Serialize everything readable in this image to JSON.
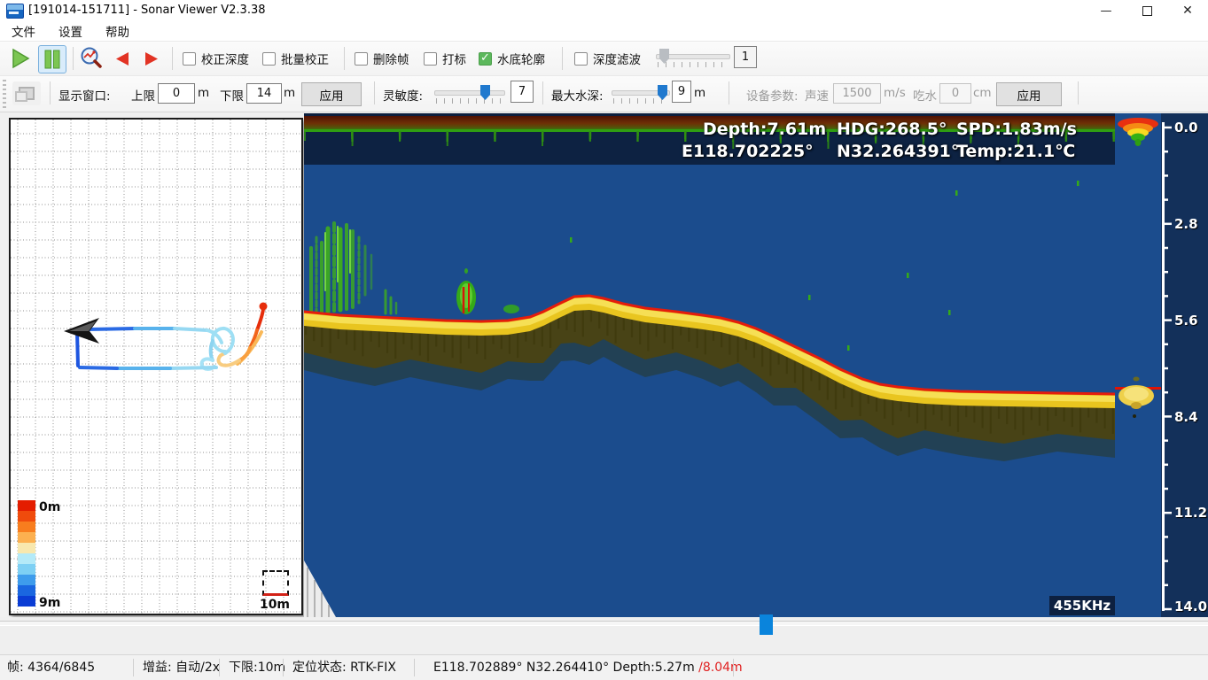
{
  "window": {
    "title": "[191014-151711] - Sonar Viewer V2.3.38",
    "minimize": "—",
    "close": "✕"
  },
  "menu": {
    "items": [
      "文件",
      "设置",
      "帮助"
    ]
  },
  "toolbar1": {
    "checkboxes": [
      {
        "label": "校正深度",
        "checked": false
      },
      {
        "label": "批量校正",
        "checked": false
      },
      {
        "label": "删除帧",
        "checked": false
      },
      {
        "label": "打标",
        "checked": false
      },
      {
        "label": "水底轮廓",
        "checked": true
      },
      {
        "label": "深度滤波",
        "checked": false
      }
    ],
    "filter_slider_value": "1"
  },
  "toolbar2": {
    "display_window_label": "显示窗口:",
    "upper_label": "上限",
    "upper_value": "0",
    "upper_unit": "m",
    "lower_label": "下限",
    "lower_value": "14",
    "lower_unit": "m",
    "apply_label": "应用",
    "sensitivity_label": "灵敏度:",
    "sensitivity_value": "7",
    "max_depth_label": "最大水深:",
    "max_depth_value": "9",
    "max_depth_unit": "m",
    "device_label": "设备参数:",
    "sound_speed_label": "声速",
    "sound_speed_value": "1500",
    "sound_speed_unit": "m/s",
    "draft_label": "吃水",
    "draft_value": "0",
    "draft_unit": "cm",
    "device_apply_label": "应用"
  },
  "map": {
    "legend_top_label": "0m",
    "legend_bottom_label": "9m",
    "scale_label": "10m"
  },
  "sonar": {
    "overlay": {
      "depth": "Depth:7.61m",
      "hdg": "HDG:268.5°",
      "spd": "SPD:1.83m/s",
      "lon": "E118.702225°",
      "lat": "N32.264391°",
      "temp": "Temp:21.1℃"
    },
    "freq_label": "455KHz",
    "depth_scale_labels": [
      "0.0",
      "2.8",
      "5.6",
      "8.4",
      "11.2",
      "14.0"
    ]
  },
  "statusbar": {
    "frame": "帧: 4364/6845",
    "gain": "增益: 自动/2x",
    "lower_limit": "下限:10m",
    "fix_status": "定位状态: RTK-FIX",
    "position": "E118.702889°  N32.264410°  Depth:5.27m ",
    "depth_alt": "/8.04m"
  }
}
